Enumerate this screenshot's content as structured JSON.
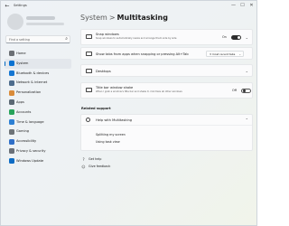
{
  "window": {
    "app_title": "Settings",
    "controls": {
      "minimize": "—",
      "maximize": "☐",
      "close": "✕"
    }
  },
  "search": {
    "placeholder": "Find a setting"
  },
  "sidebar": {
    "items": [
      {
        "label": "Home",
        "icon": "home-icon",
        "color": "#6b6f74"
      },
      {
        "label": "System",
        "icon": "monitor-icon",
        "color": "#0a72d1",
        "selected": true
      },
      {
        "label": "Bluetooth & devices",
        "icon": "bluetooth-icon",
        "color": "#1576d2"
      },
      {
        "label": "Network & internet",
        "icon": "wifi-icon",
        "color": "#4d6c8d"
      },
      {
        "label": "Personalization",
        "icon": "brush-icon",
        "color": "#d98b3a"
      },
      {
        "label": "Apps",
        "icon": "apps-icon",
        "color": "#5b6874"
      },
      {
        "label": "Accounts",
        "icon": "person-icon",
        "color": "#27a35a"
      },
      {
        "label": "Time & language",
        "icon": "clock-globe-icon",
        "color": "#2c7fd3"
      },
      {
        "label": "Gaming",
        "icon": "controller-icon",
        "color": "#6d7377"
      },
      {
        "label": "Accessibility",
        "icon": "accessibility-icon",
        "color": "#2f6fc7"
      },
      {
        "label": "Privacy & security",
        "icon": "shield-icon",
        "color": "#6a7078"
      },
      {
        "label": "Windows Update",
        "icon": "sync-icon",
        "color": "#0f6cc4"
      }
    ]
  },
  "header": {
    "parent": "System",
    "separator": ">",
    "current": "Multitasking"
  },
  "cards": {
    "snap": {
      "title": "Snap windows",
      "description": "Snap windows to automatically resize and arrange them side by side",
      "toggle_label": "On",
      "toggle_on": true
    },
    "tabs": {
      "title": "Show tabs from apps when snapping or pressing Alt+Tab",
      "dropdown_value": "3 most recent tabs"
    },
    "desktops": {
      "title": "Desktops"
    },
    "shake": {
      "title": "Title bar window shake",
      "description": "When I grab a window's title bar and shake it, minimize all other windows",
      "toggle_label": "Off",
      "toggle_on": false
    }
  },
  "related": {
    "heading": "Related support",
    "help_title": "Help with Multitasking",
    "links": [
      "Splitting my screen",
      "Using task view"
    ]
  },
  "footer": {
    "get_help": "Get help",
    "give_feedback": "Give feedback"
  }
}
